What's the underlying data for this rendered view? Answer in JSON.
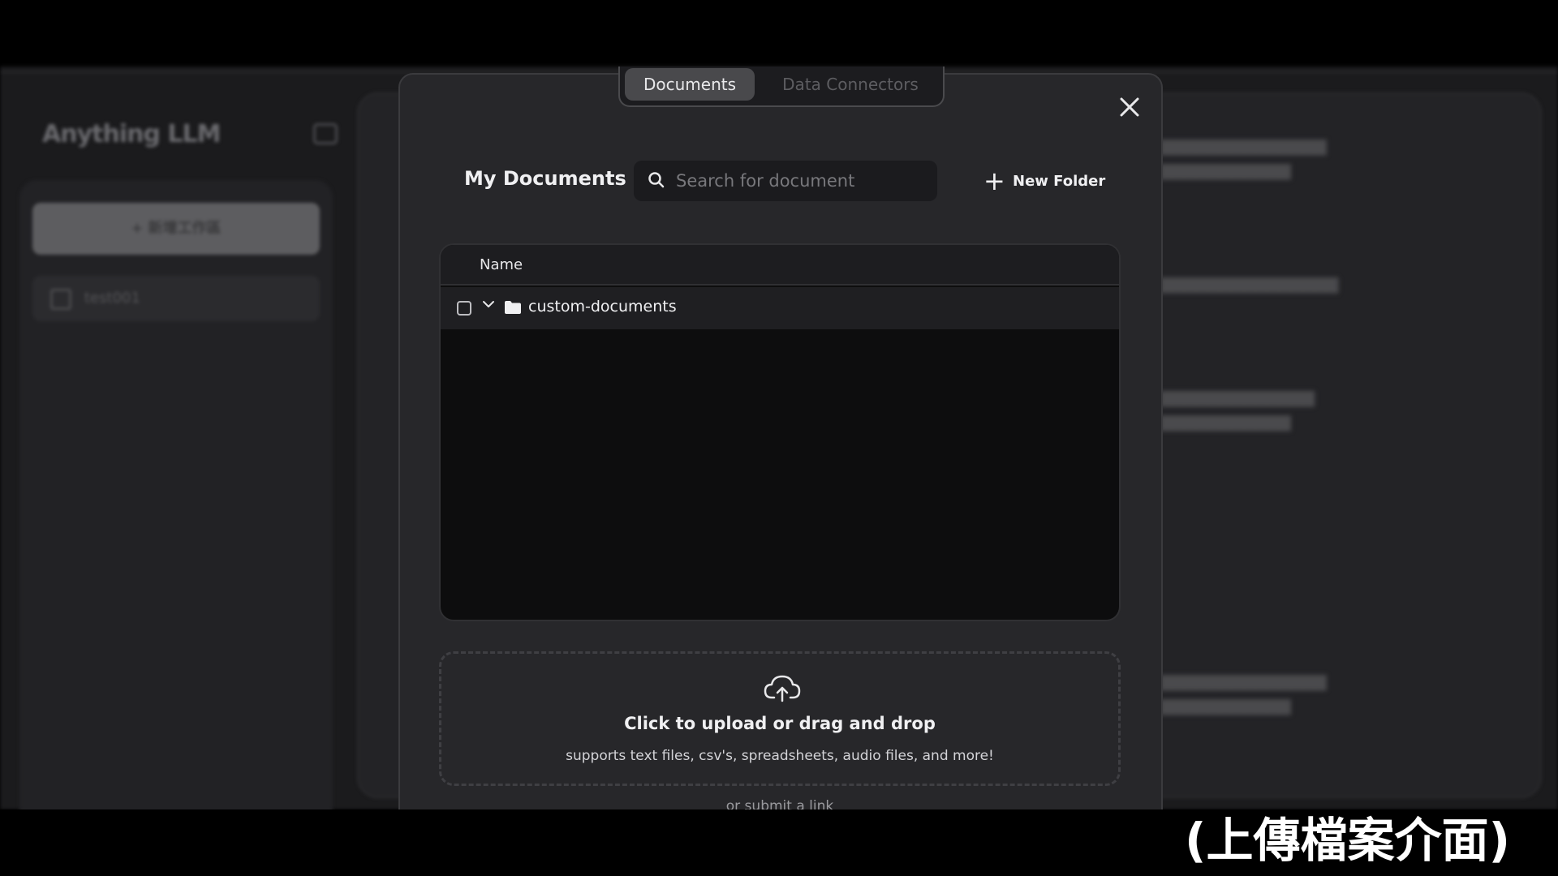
{
  "sidebar": {
    "logo": "Anything LLM",
    "new_workspace_label": "+ 新增工作區",
    "workspace_item": "test001"
  },
  "modal": {
    "tabs": [
      {
        "label": "Documents",
        "active": true
      },
      {
        "label": "Data Connectors",
        "active": false
      }
    ],
    "close_icon": "close-icon",
    "title": "My Documents",
    "search": {
      "placeholder": "Search for document",
      "value": ""
    },
    "new_folder_label": "New Folder",
    "table": {
      "columns": [
        "Name"
      ],
      "rows": [
        {
          "name": "custom-documents",
          "type": "folder",
          "expanded": true,
          "checked": false
        }
      ]
    },
    "upload": {
      "title": "Click to upload or drag and drop",
      "subtitle": "supports text files, csv's, spreadsheets, audio files, and more!",
      "submit_link": "or submit a link"
    }
  },
  "caption": "(上傳檔案介面)",
  "colors": {
    "modal_bg": "#27272a",
    "table_bg": "#0d0d0e",
    "active_tab": "#49494c",
    "text": "#f0f0f2"
  }
}
